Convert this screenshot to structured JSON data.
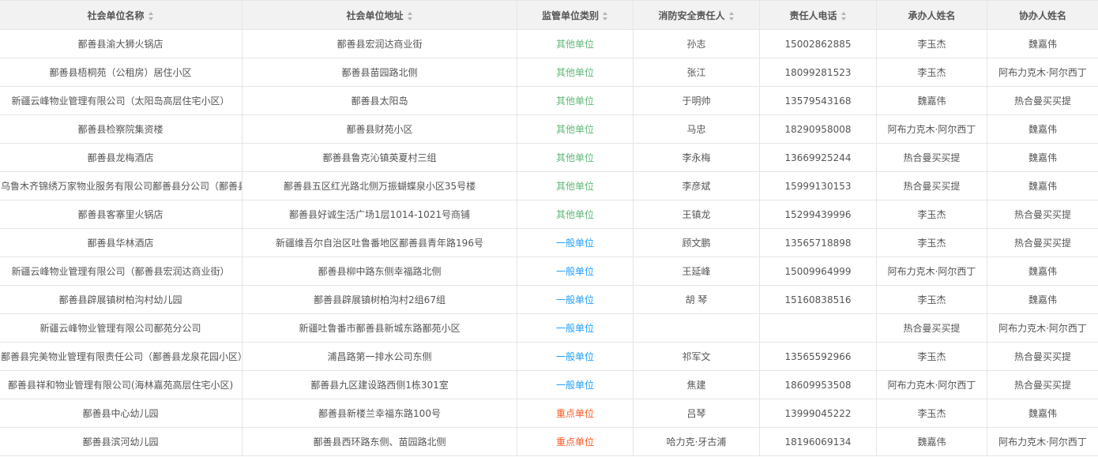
{
  "columns": [
    {
      "label": "社会单位名称",
      "sortable": true
    },
    {
      "label": "社会单位地址",
      "sortable": true
    },
    {
      "label": "监管单位类别",
      "sortable": true
    },
    {
      "label": "消防安全责任人",
      "sortable": true
    },
    {
      "label": "责任人电话",
      "sortable": true
    },
    {
      "label": "承办人姓名",
      "sortable": false
    },
    {
      "label": "协办人姓名",
      "sortable": false
    }
  ],
  "category_colors": {
    "其他单位": "#5fb878",
    "一般单位": "#1e9fff",
    "重点单位": "#ff5722"
  },
  "rows": [
    [
      "鄯善县渝大狮火锅店",
      "鄯善县宏润达商业街",
      "其他单位",
      "孙志",
      "15002862885",
      "李玉杰",
      "魏嘉伟"
    ],
    [
      "鄯善县梧桐苑（公租房）居住小区",
      "鄯善县苗园路北侧",
      "其他单位",
      "张江",
      "18099281523",
      "李玉杰",
      "阿布力克木·阿尔西丁"
    ],
    [
      "新疆云峰物业管理有限公司（太阳岛高层住宅小区）",
      "鄯善县太阳岛",
      "其他单位",
      "于明帅",
      "13579543168",
      "魏嘉伟",
      "热合曼买买提"
    ],
    [
      "鄯善县检察院集资楼",
      "鄯善县财苑小区",
      "其他单位",
      "马忠",
      "18290958008",
      "阿布力克木·阿尔西丁",
      "魏嘉伟"
    ],
    [
      "鄯善县龙梅酒店",
      "鄯善县鲁克沁镇英夏村三组",
      "其他单位",
      "李永梅",
      "13669925244",
      "热合曼买买提",
      "魏嘉伟"
    ],
    [
      "乌鲁木齐锦绣万家物业服务有限公司鄯善县分公司（鄯善县",
      "鄯善县五区红光路北侧万振蝴蝶泉小区35号楼",
      "其他单位",
      "李彦斌",
      "15999130153",
      "热合曼买买提",
      "魏嘉伟"
    ],
    [
      "鄯善县客寨里火锅店",
      "鄯善县好诚生活广场1层1014-1021号商铺",
      "其他单位",
      "王镇龙",
      "15299439996",
      "李玉杰",
      "热合曼买买提"
    ],
    [
      "鄯善县华林酒店",
      "新疆维吾尔自治区吐鲁番地区鄯善县青年路196号",
      "一般单位",
      "顾文鹏",
      "13565718898",
      "李玉杰",
      "热合曼买买提"
    ],
    [
      "新疆云峰物业管理有限公司（鄯善县宏润达商业街）",
      "鄯善县柳中路东侧幸福路北侧",
      "一般单位",
      "王延峰",
      "15009964999",
      "阿布力克木·阿尔西丁",
      "魏嘉伟"
    ],
    [
      "鄯善县辟展镇树柏沟村幼儿园",
      "鄯善县辟展镇树柏沟村2组67组",
      "一般单位",
      "胡 琴",
      "15160838516",
      "李玉杰",
      "魏嘉伟"
    ],
    [
      "新疆云峰物业管理有限公司鄯苑分公司",
      "新疆吐鲁番市鄯善县新城东路鄯苑小区",
      "一般单位",
      "",
      "",
      "热合曼买买提",
      "阿布力克木·阿尔西丁"
    ],
    [
      "鄯善县完美物业管理有限责任公司（鄯善县龙泉花园小区）",
      "浦昌路第一排水公司东侧",
      "一般单位",
      "祁军文",
      "13565592966",
      "李玉杰",
      "热合曼买买提"
    ],
    [
      "鄯善县祥和物业管理有限公司(海林嘉苑高层住宅小区)",
      "鄯善县九区建设路西侧1栋301室",
      "一般单位",
      "焦建",
      "18609953508",
      "阿布力克木·阿尔西丁",
      "热合曼买买提"
    ],
    [
      "鄯善县中心幼儿园",
      "鄯善县新楼兰幸福东路100号",
      "重点单位",
      "吕琴",
      "13999045222",
      "李玉杰",
      "魏嘉伟"
    ],
    [
      "鄯善县滨河幼儿园",
      "鄯善县西环路东侧、苗园路北侧",
      "重点单位",
      "哈力克·牙古浦",
      "18196069134",
      "魏嘉伟",
      "阿布力克木·阿尔西丁"
    ]
  ]
}
